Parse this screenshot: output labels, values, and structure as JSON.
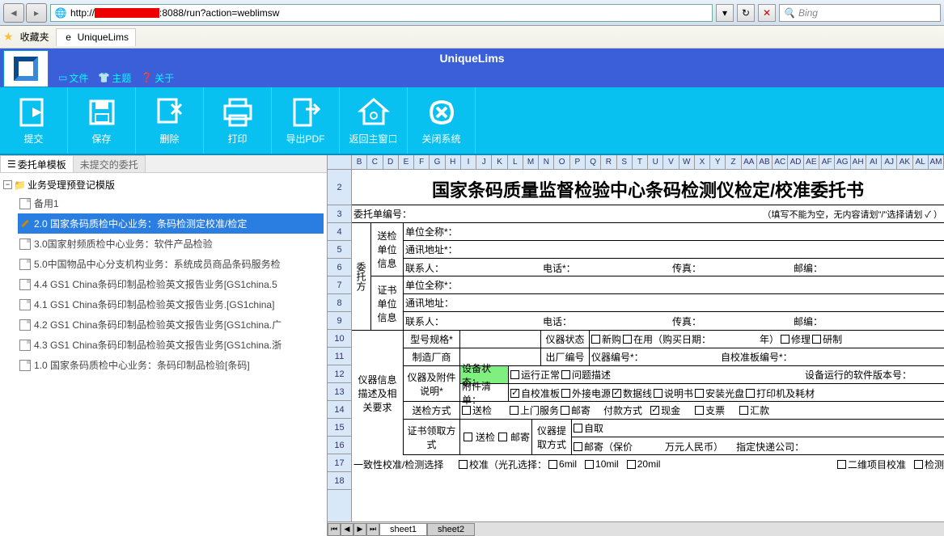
{
  "browser": {
    "url_prefix": "http://",
    "url_suffix": ":8088/run?action=weblimsw",
    "search_placeholder": "Bing",
    "favorites_label": "收藏夹",
    "tab_title": "UniqueLims"
  },
  "app": {
    "title": "UniqueLims",
    "menu": {
      "file": "文件",
      "theme": "主题",
      "about": "关于"
    }
  },
  "toolbar": {
    "submit": "提交",
    "save": "保存",
    "delete": "删除",
    "print": "打印",
    "export_pdf": "导出PDF",
    "return_main": "返回主窗口",
    "close_sys": "关闭系统"
  },
  "sidebar": {
    "tabs": {
      "template": "委托单模板",
      "unsubmitted": "未提交的委托"
    },
    "root": "业务受理预登记模版",
    "items": [
      {
        "label": "备用1",
        "selected": false
      },
      {
        "label": "2.0 国家条码质检中心业务：条码检测定校准/检定",
        "selected": true
      },
      {
        "label": "3.0国家射频质检中心业务：软件产品检验",
        "selected": false
      },
      {
        "label": "5.0中国物品中心分支机构业务：系统成员商品条码服务检",
        "selected": false
      },
      {
        "label": "4.4 GS1 China条码印制品检验英文报告业务[GS1china.5",
        "selected": false
      },
      {
        "label": "4.1 GS1 China条码印制品检验英文报告业务.[GS1china]",
        "selected": false
      },
      {
        "label": "4.2 GS1 China条码印制品检验英文报告业务[GS1china.广",
        "selected": false
      },
      {
        "label": "4.3 GS1 China条码印制品检验英文报告业务[GS1china.浙",
        "selected": false
      },
      {
        "label": "1.0 国家条码质检中心业务：条码印制品检验[条码]",
        "selected": false
      }
    ]
  },
  "sheet": {
    "cols": [
      "B",
      "C",
      "D",
      "E",
      "F",
      "G",
      "H",
      "I",
      "J",
      "K",
      "L",
      "M",
      "N",
      "O",
      "P",
      "Q",
      "R",
      "S",
      "T",
      "U",
      "V",
      "W",
      "X",
      "Y",
      "Z",
      "AA",
      "AB",
      "AC",
      "AD",
      "AE",
      "AF",
      "AG",
      "AH",
      "AI",
      "AJ",
      "AK",
      "AL",
      "AM"
    ],
    "rows": [
      2,
      3,
      4,
      5,
      6,
      7,
      8,
      9,
      10,
      11,
      12,
      13,
      14,
      15,
      16,
      17,
      18
    ],
    "title": "国家条码质量监督检验中心条码检测仪检定/校准委托书",
    "order_no_label": "委托单编号：",
    "hint": "（填写不能为空，无内容请划\"/\"选择请划 ✓ ）",
    "client_block": "委托方",
    "send_unit": "送检单位信息",
    "cert_unit": "证书单位信息",
    "unit_name": "单位全称*：",
    "address": "通讯地址*：",
    "address2": "通讯地址：",
    "contact": "联系人：",
    "phone": "电话*：",
    "phone2": "电话：",
    "fax": "传真：",
    "zip": "邮编：",
    "instrument_info": "仪器信息描述及相关要求",
    "model": "型号规格*",
    "instr_status": "仪器状态",
    "new_buy": "新购",
    "in_use": "在用（购买日期：",
    "year": "年）",
    "repair": "修理",
    "trial": "研制",
    "manufacturer": "制造厂商",
    "factory_no": "出厂编号",
    "instr_no": "仪器编号*：",
    "self_cal_board_no": "自校准板编号*：",
    "attach_desc": "仪器及附件说明*",
    "device_status": "设备状态：",
    "run_normal": "运行正常",
    "problem_desc": "问题描述",
    "software_ver": "设备运行的软件版本号：",
    "attach_list": "附件清单：",
    "self_cal_board": "自校准板",
    "ext_power": "外接电源",
    "data_cable": "数据线",
    "manual": "说明书",
    "install_cd": "安装光盘",
    "printer": "打印机及耗材",
    "send_method": "送检方式",
    "send": "送检",
    "door_service": "上门服务",
    "mail": "邮寄",
    "pay_method": "付款方式",
    "cash": "现金",
    "check": "支票",
    "remit": "汇款",
    "cert_recv": "证书领取方式",
    "self_pickup": "自取",
    "instr_return": "仪器提取方式",
    "mail2": "邮寄（保价",
    "rmb": "万元人民币）",
    "courier": "指定快递公司：",
    "consistency": "一致性校准/检测选择",
    "calibration": "校准（光孔选择：",
    "6mil": "6mil",
    "10mil": "10mil",
    "20mil": "20mil",
    "2d_cal": "二维项目校准",
    "detect": "检测",
    "tabs": {
      "sheet1": "sheet1",
      "sheet2": "sheet2"
    }
  }
}
